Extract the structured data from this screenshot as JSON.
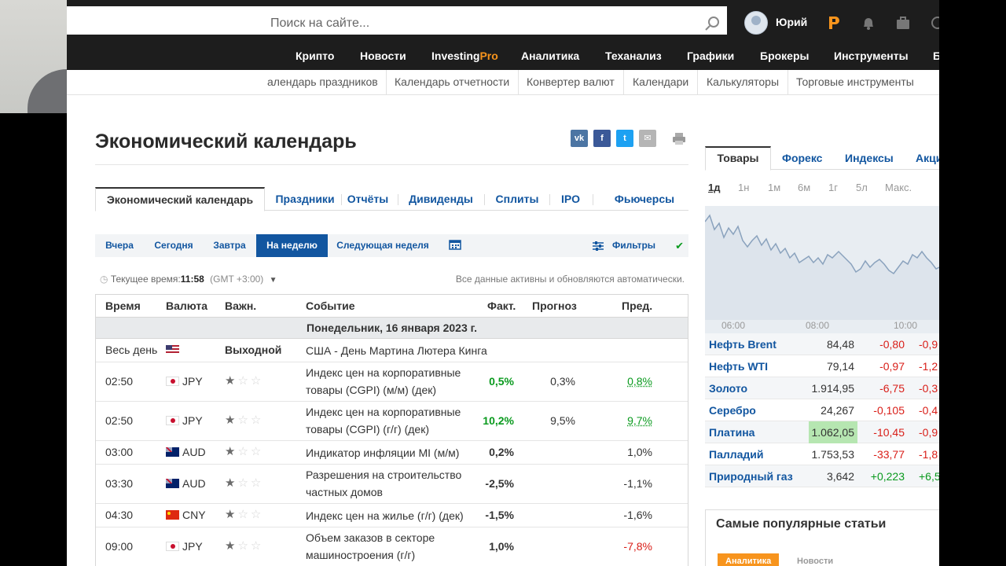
{
  "header": {
    "search_placeholder": "Поиск на сайте...",
    "user_name": "Юрий"
  },
  "nav": {
    "items": [
      "Крипто",
      "Новости",
      "Investing",
      "Pro",
      "Аналитика",
      "Теханализ",
      "Графики",
      "Брокеры",
      "Инструменты",
      "Б"
    ]
  },
  "subnav": {
    "items": [
      "алендарь праздников",
      "Календарь отчетности",
      "Конвертер валют",
      "Календари",
      "Калькуляторы",
      "Торговые инструменты"
    ]
  },
  "page": {
    "title": "Экономический календарь"
  },
  "share_icons": [
    "vk-icon",
    "facebook-icon",
    "twitter-icon",
    "email-icon",
    "print-icon"
  ],
  "tabs": [
    "Экономический календарь",
    "Праздники",
    "Отчёты",
    "Дивиденды",
    "Сплиты",
    "IPO",
    "Фьючерсы"
  ],
  "datebar": {
    "buttons": [
      "Вчера",
      "Сегодня",
      "Завтра",
      "На неделю",
      "Следующая неделя"
    ],
    "active": "На неделю",
    "filters_label": "Фильтры"
  },
  "timeinfo": {
    "label": "Текущее время:",
    "time": "11:58",
    "zone": "(GMT +3:00)",
    "auto_note": "Все данные активны и обновляются автоматически."
  },
  "calendar": {
    "headers": [
      "Время",
      "Валюта",
      "Важн.",
      "Событие",
      "Факт.",
      "Прогноз",
      "Пред."
    ],
    "day_label": "Понедельник, 16 января 2023 г.",
    "holiday": {
      "time": "Весь день",
      "importance": "Выходной",
      "event": "США - День Мартина Лютера Кинга"
    },
    "rows": [
      {
        "time": "02:50",
        "currency": "JPY",
        "flag": "jp",
        "stars": 1,
        "event": "Индекс цен на корпоративные товары (CGPI) (м/м) (дек)",
        "actual": "0,5%",
        "actual_color": "green",
        "forecast": "0,3%",
        "previous": "0,8%",
        "previous_color": "green"
      },
      {
        "time": "02:50",
        "currency": "JPY",
        "flag": "jp",
        "stars": 1,
        "event": "Индекс цен на корпоративные товары (CGPI) (г/г) (дек)",
        "actual": "10,2%",
        "actual_color": "green",
        "forecast": "9,5%",
        "previous": "9,7%",
        "previous_color": "green"
      },
      {
        "time": "03:00",
        "currency": "AUD",
        "flag": "au",
        "stars": 1,
        "event": "Индикатор инфляции MI (м/м)",
        "actual": "0,2%",
        "actual_color": "black",
        "forecast": "",
        "previous": "1,0%",
        "previous_color": "black"
      },
      {
        "time": "03:30",
        "currency": "AUD",
        "flag": "au",
        "stars": 1,
        "event": "Разрешения на строительство частных домов",
        "actual": "-2,5%",
        "actual_color": "black",
        "forecast": "",
        "previous": "-1,1%",
        "previous_color": "black"
      },
      {
        "time": "04:30",
        "currency": "CNY",
        "flag": "cn",
        "stars": 1,
        "event": "Индекс цен на жилье (г/г) (дек)",
        "actual": "-1,5%",
        "actual_color": "black",
        "forecast": "",
        "previous": "-1,6%",
        "previous_color": "black"
      },
      {
        "time": "09:00",
        "currency": "JPY",
        "flag": "jp",
        "stars": 1,
        "event": "Объем заказов в секторе машиностроения (г/г)",
        "actual": "1,0%",
        "actual_color": "black",
        "forecast": "",
        "previous": "-7,8%",
        "previous_color": "red"
      }
    ]
  },
  "sidebar": {
    "tabs": [
      "Товары",
      "Форекс",
      "Индексы",
      "Акци"
    ],
    "periods": [
      "1д",
      "1н",
      "1м",
      "6м",
      "1г",
      "5л",
      "Макс."
    ],
    "chart_ticks": [
      "06:00",
      "08:00",
      "10:00"
    ],
    "commodities": [
      {
        "name": "Нефть Brent",
        "price": "84,48",
        "change": "-0,80",
        "pct": "-0,9",
        "color": "red"
      },
      {
        "name": "Нефть WTI",
        "price": "79,14",
        "change": "-0,97",
        "pct": "-1,2",
        "color": "red"
      },
      {
        "name": "Золото",
        "price": "1.914,95",
        "change": "-6,75",
        "pct": "-0,3",
        "color": "red"
      },
      {
        "name": "Серебро",
        "price": "24,267",
        "change": "-0,105",
        "pct": "-0,4",
        "color": "red"
      },
      {
        "name": "Платина",
        "price": "1.062,05",
        "change": "-10,45",
        "pct": "-0,9",
        "color": "red",
        "highlight": true
      },
      {
        "name": "Палладий",
        "price": "1.753,53",
        "change": "-33,77",
        "pct": "-1,8",
        "color": "red"
      },
      {
        "name": "Природный газ",
        "price": "3,642",
        "change": "+0,223",
        "pct": "+6,5",
        "color": "green"
      }
    ],
    "popular_title": "Самые популярные статьи",
    "popular_tabs": [
      "Аналитика",
      "Новости"
    ]
  },
  "colors": {
    "accent": "#1256a0",
    "green": "#0a9a1e",
    "red": "#d91e18",
    "nav_bg": "#1d1d1d",
    "pro": "#f7941d"
  }
}
